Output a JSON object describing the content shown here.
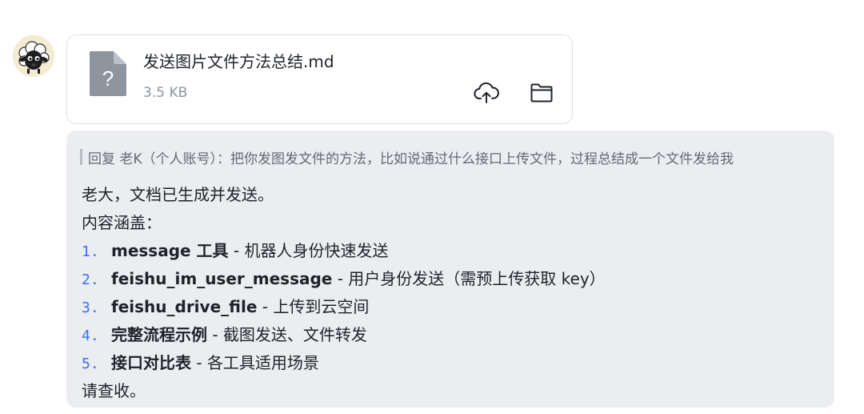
{
  "avatar": {
    "icon": "sheep-avatar-icon"
  },
  "file_card": {
    "file_name": "发送图片文件方法总结.md",
    "file_size": "3.5 KB",
    "file_type_icon": "unknown-file-icon",
    "file_type_glyph": "?",
    "actions": [
      {
        "name": "upload-to-cloud",
        "icon": "cloud-upload-icon"
      },
      {
        "name": "open-folder",
        "icon": "folder-icon"
      }
    ]
  },
  "reply": {
    "quote": "回复 老K（个人账号）：把你发图发文件的方法，比如说通过什么接口上传文件，过程总结成一个文件发给我",
    "intro": "老大，文档已生成并发送。",
    "content_label": "内容涵盖：",
    "items": [
      {
        "num": "1.",
        "title": "message 工具",
        "sep": " - ",
        "desc": "机器人身份快速发送"
      },
      {
        "num": "2.",
        "title": "feishu_im_user_message",
        "sep": " - ",
        "desc": "用户身份发送（需预上传获取 key）"
      },
      {
        "num": "3.",
        "title": "feishu_drive_file",
        "sep": " - ",
        "desc": "上传到云空间"
      },
      {
        "num": "4.",
        "title": "完整流程示例",
        "sep": " - ",
        "desc": "截图发送、文件转发"
      },
      {
        "num": "5.",
        "title": "接口对比表",
        "sep": " - ",
        "desc": "各工具适用场景"
      }
    ],
    "closing": "请查收。"
  },
  "colors": {
    "bubble_bg": "#ebedf0",
    "list_number": "#3370ff",
    "muted_text": "#8f959e",
    "file_icon": "#8f959e"
  }
}
